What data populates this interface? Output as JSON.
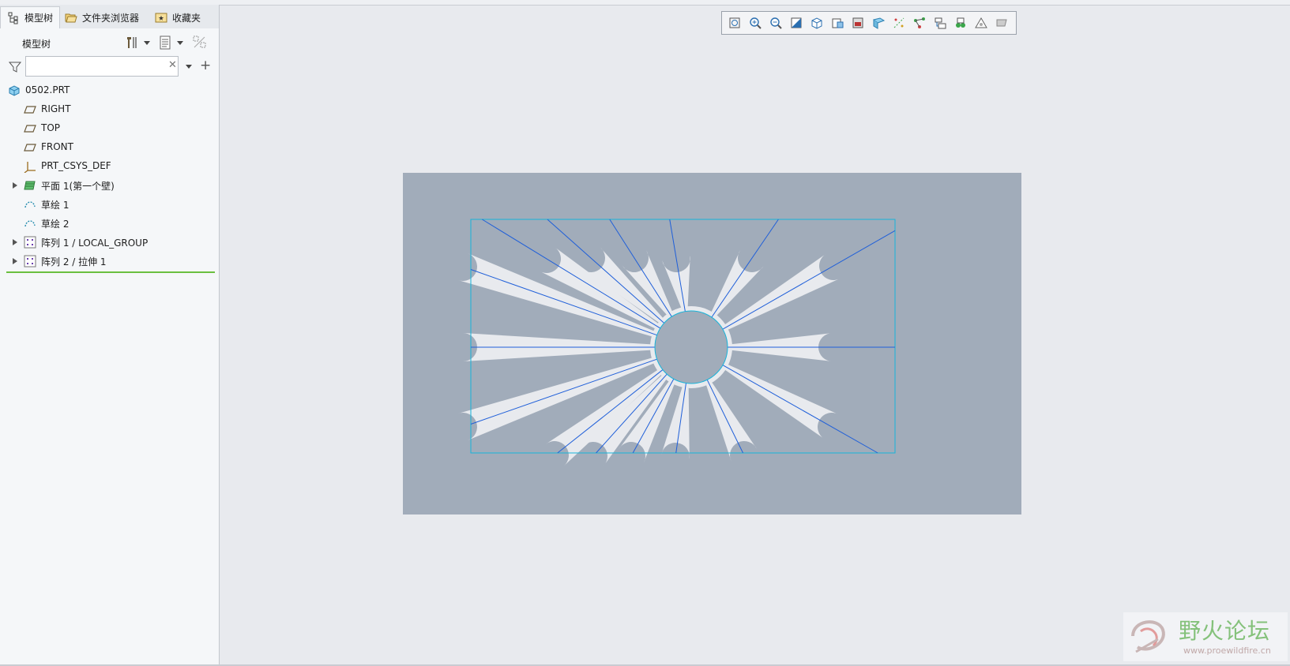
{
  "tabs": [
    {
      "label": "模型树",
      "icon": "model-tree-icon"
    },
    {
      "label": "文件夹浏览器",
      "icon": "folder-browser-icon"
    },
    {
      "label": "收藏夹",
      "icon": "favorites-icon"
    }
  ],
  "tree_header": {
    "title": "模型树"
  },
  "filter": {
    "value": "",
    "placeholder": ""
  },
  "tree_items": [
    {
      "label": "0502.PRT",
      "icon": "part-icon",
      "expandable": false
    },
    {
      "label": "RIGHT",
      "icon": "datum-plane-icon",
      "expandable": false
    },
    {
      "label": "TOP",
      "icon": "datum-plane-icon",
      "expandable": false
    },
    {
      "label": "FRONT",
      "icon": "datum-plane-icon",
      "expandable": false
    },
    {
      "label": "PRT_CSYS_DEF",
      "icon": "csys-icon",
      "expandable": false
    },
    {
      "label": "平面 1(第一个壁)",
      "icon": "sheetmetal-wall-icon",
      "expandable": true
    },
    {
      "label": "草绘 1",
      "icon": "sketch-icon",
      "expandable": false
    },
    {
      "label": "草绘 2",
      "icon": "sketch-icon",
      "expandable": false
    },
    {
      "label": "阵列 1 / LOCAL_GROUP",
      "icon": "pattern-icon",
      "expandable": true
    },
    {
      "label": "阵列 2 / 拉伸 1",
      "icon": "pattern-icon",
      "expandable": true
    }
  ],
  "view_toolbar": [
    "refit-icon",
    "zoom-in-icon",
    "zoom-out-icon",
    "repaint-icon",
    "display-style-icon",
    "saved-orientations-icon",
    "view-manager-icon",
    "perspective-icon",
    "datum-display-icon",
    "annotation-display-icon",
    "spin-center-icon",
    "section-icon",
    "appearance-icon",
    "plane-display-icon"
  ],
  "colors": {
    "viewport_bg": "#a1acba",
    "part_fill": "#e8eaee",
    "sketch_edge": "#1f5fd9",
    "sketch_box": "#18b4da",
    "insert_line": "#6abf3f"
  },
  "watermark": {
    "text": "野火论坛",
    "url": "www.proewildfire.cn"
  }
}
